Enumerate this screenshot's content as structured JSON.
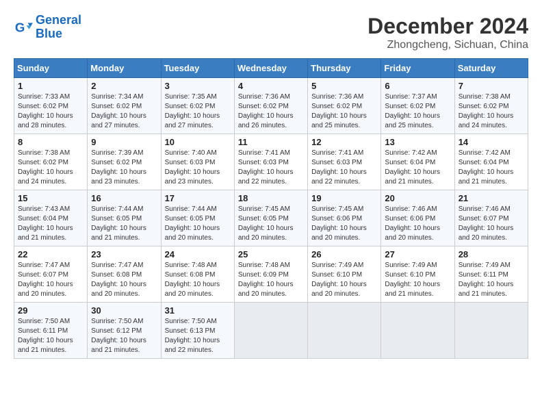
{
  "logo": {
    "line1": "General",
    "line2": "Blue"
  },
  "title": "December 2024",
  "subtitle": "Zhongcheng, Sichuan, China",
  "weekdays": [
    "Sunday",
    "Monday",
    "Tuesday",
    "Wednesday",
    "Thursday",
    "Friday",
    "Saturday"
  ],
  "weeks": [
    [
      {
        "day": "1",
        "info": "Sunrise: 7:33 AM\nSunset: 6:02 PM\nDaylight: 10 hours\nand 28 minutes."
      },
      {
        "day": "2",
        "info": "Sunrise: 7:34 AM\nSunset: 6:02 PM\nDaylight: 10 hours\nand 27 minutes."
      },
      {
        "day": "3",
        "info": "Sunrise: 7:35 AM\nSunset: 6:02 PM\nDaylight: 10 hours\nand 27 minutes."
      },
      {
        "day": "4",
        "info": "Sunrise: 7:36 AM\nSunset: 6:02 PM\nDaylight: 10 hours\nand 26 minutes."
      },
      {
        "day": "5",
        "info": "Sunrise: 7:36 AM\nSunset: 6:02 PM\nDaylight: 10 hours\nand 25 minutes."
      },
      {
        "day": "6",
        "info": "Sunrise: 7:37 AM\nSunset: 6:02 PM\nDaylight: 10 hours\nand 25 minutes."
      },
      {
        "day": "7",
        "info": "Sunrise: 7:38 AM\nSunset: 6:02 PM\nDaylight: 10 hours\nand 24 minutes."
      }
    ],
    [
      {
        "day": "8",
        "info": "Sunrise: 7:38 AM\nSunset: 6:02 PM\nDaylight: 10 hours\nand 24 minutes."
      },
      {
        "day": "9",
        "info": "Sunrise: 7:39 AM\nSunset: 6:02 PM\nDaylight: 10 hours\nand 23 minutes."
      },
      {
        "day": "10",
        "info": "Sunrise: 7:40 AM\nSunset: 6:03 PM\nDaylight: 10 hours\nand 23 minutes."
      },
      {
        "day": "11",
        "info": "Sunrise: 7:41 AM\nSunset: 6:03 PM\nDaylight: 10 hours\nand 22 minutes."
      },
      {
        "day": "12",
        "info": "Sunrise: 7:41 AM\nSunset: 6:03 PM\nDaylight: 10 hours\nand 22 minutes."
      },
      {
        "day": "13",
        "info": "Sunrise: 7:42 AM\nSunset: 6:04 PM\nDaylight: 10 hours\nand 21 minutes."
      },
      {
        "day": "14",
        "info": "Sunrise: 7:42 AM\nSunset: 6:04 PM\nDaylight: 10 hours\nand 21 minutes."
      }
    ],
    [
      {
        "day": "15",
        "info": "Sunrise: 7:43 AM\nSunset: 6:04 PM\nDaylight: 10 hours\nand 21 minutes."
      },
      {
        "day": "16",
        "info": "Sunrise: 7:44 AM\nSunset: 6:05 PM\nDaylight: 10 hours\nand 21 minutes."
      },
      {
        "day": "17",
        "info": "Sunrise: 7:44 AM\nSunset: 6:05 PM\nDaylight: 10 hours\nand 20 minutes."
      },
      {
        "day": "18",
        "info": "Sunrise: 7:45 AM\nSunset: 6:05 PM\nDaylight: 10 hours\nand 20 minutes."
      },
      {
        "day": "19",
        "info": "Sunrise: 7:45 AM\nSunset: 6:06 PM\nDaylight: 10 hours\nand 20 minutes."
      },
      {
        "day": "20",
        "info": "Sunrise: 7:46 AM\nSunset: 6:06 PM\nDaylight: 10 hours\nand 20 minutes."
      },
      {
        "day": "21",
        "info": "Sunrise: 7:46 AM\nSunset: 6:07 PM\nDaylight: 10 hours\nand 20 minutes."
      }
    ],
    [
      {
        "day": "22",
        "info": "Sunrise: 7:47 AM\nSunset: 6:07 PM\nDaylight: 10 hours\nand 20 minutes."
      },
      {
        "day": "23",
        "info": "Sunrise: 7:47 AM\nSunset: 6:08 PM\nDaylight: 10 hours\nand 20 minutes."
      },
      {
        "day": "24",
        "info": "Sunrise: 7:48 AM\nSunset: 6:08 PM\nDaylight: 10 hours\nand 20 minutes."
      },
      {
        "day": "25",
        "info": "Sunrise: 7:48 AM\nSunset: 6:09 PM\nDaylight: 10 hours\nand 20 minutes."
      },
      {
        "day": "26",
        "info": "Sunrise: 7:49 AM\nSunset: 6:10 PM\nDaylight: 10 hours\nand 20 minutes."
      },
      {
        "day": "27",
        "info": "Sunrise: 7:49 AM\nSunset: 6:10 PM\nDaylight: 10 hours\nand 21 minutes."
      },
      {
        "day": "28",
        "info": "Sunrise: 7:49 AM\nSunset: 6:11 PM\nDaylight: 10 hours\nand 21 minutes."
      }
    ],
    [
      {
        "day": "29",
        "info": "Sunrise: 7:50 AM\nSunset: 6:11 PM\nDaylight: 10 hours\nand 21 minutes."
      },
      {
        "day": "30",
        "info": "Sunrise: 7:50 AM\nSunset: 6:12 PM\nDaylight: 10 hours\nand 21 minutes."
      },
      {
        "day": "31",
        "info": "Sunrise: 7:50 AM\nSunset: 6:13 PM\nDaylight: 10 hours\nand 22 minutes."
      },
      {
        "day": "",
        "info": ""
      },
      {
        "day": "",
        "info": ""
      },
      {
        "day": "",
        "info": ""
      },
      {
        "day": "",
        "info": ""
      }
    ]
  ]
}
